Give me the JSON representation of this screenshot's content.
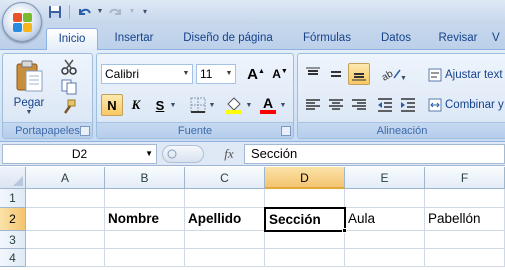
{
  "ribbon_tabs": [
    "Inicio",
    "Insertar",
    "Diseño de página",
    "Fórmulas",
    "Datos",
    "Revisar",
    "V"
  ],
  "clipboard": {
    "paste_label": "Pegar",
    "group_label": "Portapapeles"
  },
  "font": {
    "name": "Calibri",
    "size": "11",
    "bold": "N",
    "italic": "K",
    "underline": "S",
    "group_label": "Fuente"
  },
  "alignment": {
    "wrap_text": "Ajustar text",
    "merge": "Combinar y",
    "group_label": "Alineación"
  },
  "formula_bar": {
    "name_box": "D2",
    "fx": "fx",
    "content": "Sección"
  },
  "grid": {
    "columns": [
      "A",
      "B",
      "C",
      "D",
      "E",
      "F"
    ],
    "rows": [
      "1",
      "2",
      "3",
      "4"
    ],
    "row2": {
      "B": "Nombre",
      "C": "Apellido",
      "D": "Sección",
      "E": "Aula",
      "F": "Pabellón"
    }
  },
  "colors": {
    "font_color": "#ff0000",
    "highlight": "#ffff00",
    "accent": "#f4c471"
  }
}
